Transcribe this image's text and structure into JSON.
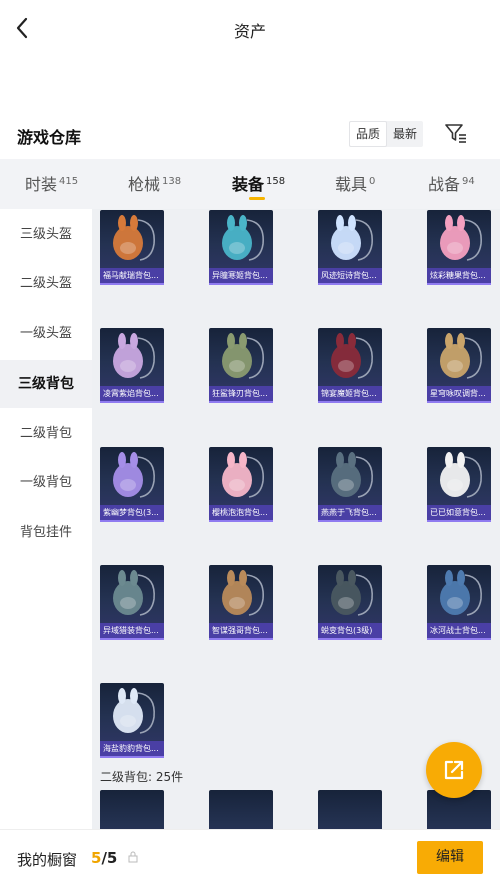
{
  "header": {
    "title": "资产"
  },
  "section": {
    "title": "游戏仓库"
  },
  "sort": {
    "options": [
      "品质",
      "最新"
    ]
  },
  "tabs": [
    {
      "label": "时装",
      "count": "415"
    },
    {
      "label": "枪械",
      "count": "138"
    },
    {
      "label": "装备",
      "count": "158"
    },
    {
      "label": "载具",
      "count": "0"
    },
    {
      "label": "战备",
      "count": "94"
    }
  ],
  "sidebar": {
    "items": [
      "三级头盔",
      "二级头盔",
      "一级头盔",
      "三级背包",
      "二级背包",
      "一级背包",
      "背包挂件"
    ]
  },
  "items": [
    {
      "name": "福马献瑞背包...",
      "icon": "fox-backpack-icon",
      "color": "#d77a3a"
    },
    {
      "name": "异瞳寒姬背包...",
      "icon": "rabbit-backpack-icon",
      "color": "#4ab5c9"
    },
    {
      "name": "风迹短诗背包...",
      "icon": "cat-backpack-icon",
      "color": "#cfe3ff"
    },
    {
      "name": "炫彩糖果背包...",
      "icon": "candy-backpack-icon",
      "color": "#f4a0c0"
    },
    {
      "name": "凌霄紫焰背包...",
      "icon": "sphere-backpack-icon",
      "color": "#c9a8e0"
    },
    {
      "name": "狂鲨锋刃背包...",
      "icon": "shark-backpack-icon",
      "color": "#8a9b70"
    },
    {
      "name": "锦宴魔姬背包...",
      "icon": "bat-backpack-icon",
      "color": "#8a2b3a"
    },
    {
      "name": "星穹咏叹调背...",
      "icon": "box-backpack-icon",
      "color": "#c9a46a"
    },
    {
      "name": "紫幽梦背包(3...",
      "icon": "orb-backpack-icon",
      "color": "#a58ee8"
    },
    {
      "name": "樱桃泡泡背包...",
      "icon": "bow-backpack-icon",
      "color": "#f6b6c8"
    },
    {
      "name": "燕燕于飞背包...",
      "icon": "mask-backpack-icon",
      "color": "#5a7080"
    },
    {
      "name": "已已如意背包...",
      "icon": "pig-backpack-icon",
      "color": "#f2f2f2"
    },
    {
      "name": "异域猎装背包...",
      "icon": "hunter-backpack-icon",
      "color": "#6c8a90"
    },
    {
      "name": "智谋强哥背包...",
      "icon": "bear-backpack-icon",
      "color": "#b98a5a"
    },
    {
      "name": "蜕变背包(3级)",
      "icon": "tactical-backpack-icon",
      "color": "#4a5860"
    },
    {
      "name": "冰河战士背包...",
      "icon": "armor-backpack-icon",
      "color": "#4e7bb0"
    },
    {
      "name": "海盐豹豹背包...",
      "icon": "leopard-backpack-icon",
      "color": "#dfe9f7"
    }
  ],
  "group": {
    "label": "二级背包: 25件"
  },
  "footer": {
    "label": "我的橱窗",
    "current": "5",
    "separator": "/",
    "total": "5",
    "edit_label": "编辑"
  },
  "colors": {
    "accent": "#f8ab05",
    "item_label_bg": "#4a3fa5",
    "item_bg": "#1d2940"
  }
}
